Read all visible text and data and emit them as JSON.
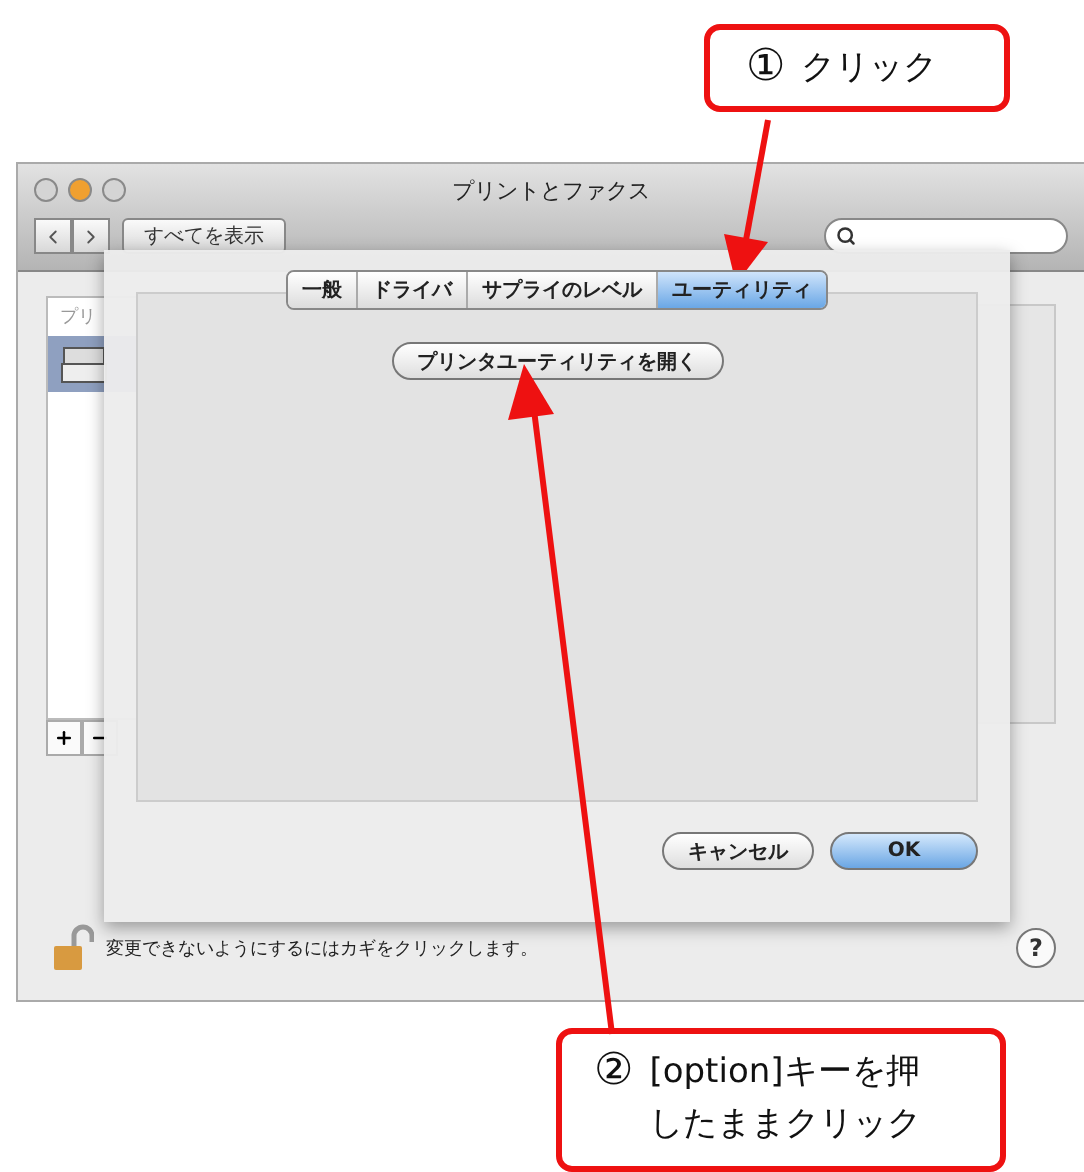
{
  "window": {
    "title": "プリントとファクス",
    "show_all": "すべてを表示"
  },
  "sidebar": {
    "header": "プリ"
  },
  "sheet": {
    "tabs": [
      {
        "label": "一般",
        "selected": false
      },
      {
        "label": "ドライバ",
        "selected": false
      },
      {
        "label": "サプライのレベル",
        "selected": false
      },
      {
        "label": "ユーティリティ",
        "selected": true
      }
    ],
    "open_utility": "プリンタユーティリティを開く",
    "buttons": [
      {
        "label": "キャンセル",
        "default": false
      },
      {
        "label": "OK",
        "default": true
      }
    ]
  },
  "lock": {
    "locked": false,
    "text": "変更できないようにするにはカギをクリックします。"
  },
  "help": "?",
  "callouts": [
    {
      "number": "①",
      "lines": [
        "クリック"
      ]
    },
    {
      "number": "②",
      "lines": [
        "[option]キーを押",
        "したままクリック"
      ]
    }
  ]
}
